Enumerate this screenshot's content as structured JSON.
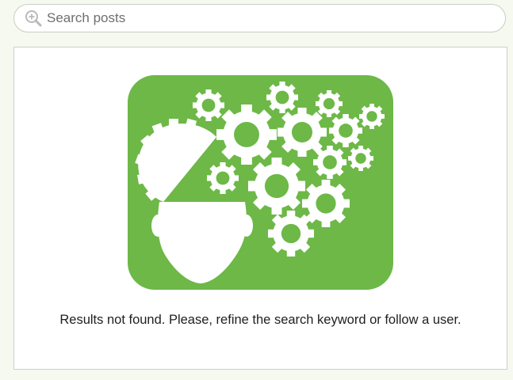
{
  "search": {
    "placeholder": "Search posts",
    "value": "",
    "icon": "zoom-in-search-icon"
  },
  "results": {
    "message": "Results not found. Please, refine the search keyword or follow a user.",
    "illustration": "mind-gears-illustration"
  },
  "colors": {
    "illustration_background": "#6db847",
    "page_background": "#f5f9ef",
    "panel_border": "#cfcfcf"
  }
}
